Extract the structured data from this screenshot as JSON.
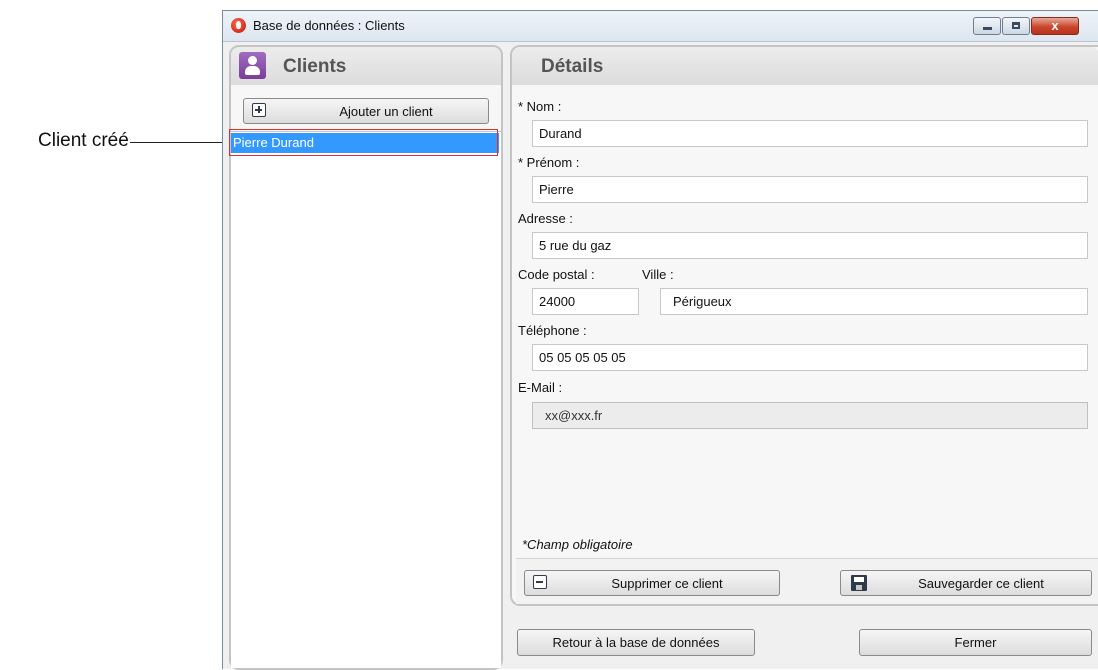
{
  "annotation": {
    "label": "Client créé"
  },
  "window": {
    "title": "Base de données : Clients",
    "close_glyph": "x"
  },
  "clients_panel": {
    "title": "Clients",
    "add_button_label": "Ajouter un client",
    "items": [
      "Pierre Durand"
    ]
  },
  "details": {
    "title": "Détails",
    "nom_label": "* Nom :",
    "nom_value": "Durand",
    "prenom_label": "* Prénom :",
    "prenom_value": "Pierre",
    "adresse_label": "Adresse :",
    "adresse_value": "5 rue du gaz",
    "cp_label": "Code postal :",
    "cp_value": "24000",
    "ville_label": "Ville :",
    "ville_value": "Périgueux",
    "tel_label": "Téléphone :",
    "tel_value": "05 05 05 05 05",
    "email_label": "E-Mail :",
    "email_value": "xx@xxx.fr",
    "required_note": "*Champ obligatoire",
    "delete_button_label": "Supprimer ce client",
    "save_button_label": "Sauvegarder ce client"
  },
  "footer": {
    "back_button_label": "Retour à la base de données",
    "close_button_label": "Fermer"
  },
  "colors": {
    "selection": "#3399ff",
    "highlight_box": "#e03030",
    "close_button": "#c9472d"
  }
}
